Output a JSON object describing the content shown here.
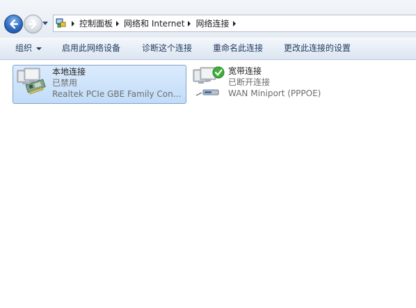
{
  "address_bar": {
    "breadcrumbs": [
      "控制面板",
      "网络和 Internet",
      "网络连接"
    ]
  },
  "command_bar": {
    "organize": "组织",
    "enable_device": "启用此网络设备",
    "diagnose": "诊断这个连接",
    "rename": "重命名此连接",
    "change_settings": "更改此连接的设置"
  },
  "connections": [
    {
      "name": "本地连接",
      "status": "已禁用",
      "device": "Realtek PCIe GBE Family Contr...",
      "icon": "lan-adapter-disabled-icon"
    },
    {
      "name": "宽带连接",
      "status": "已断开连接",
      "device": "WAN Miniport (PPPOE)",
      "icon": "broadband-connection-icon"
    }
  ],
  "colors": {
    "selection_fill": "#cfe4fb",
    "selection_border": "#7da2ce",
    "command_text": "#1e395b",
    "status_text": "#6d6d6d"
  }
}
